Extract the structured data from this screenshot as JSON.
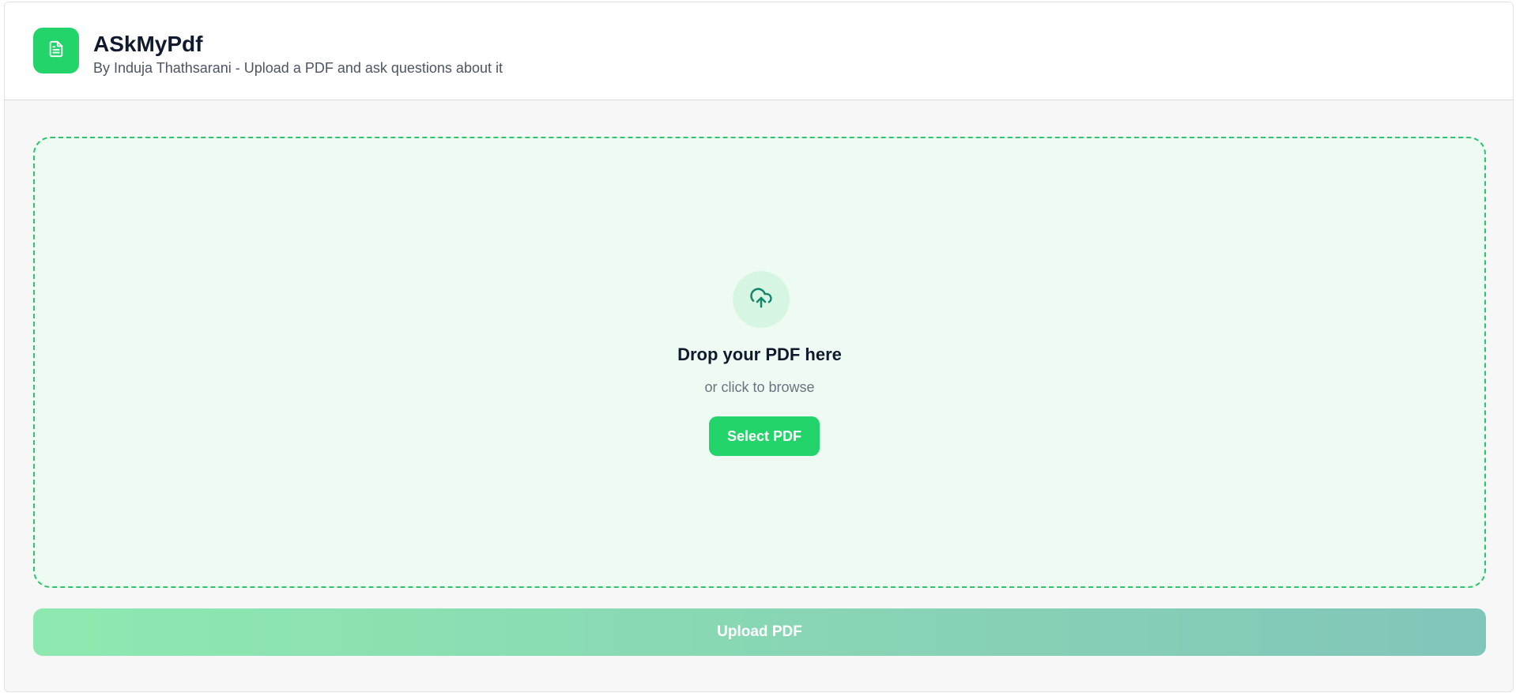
{
  "header": {
    "app_name": "ASkMyPdf",
    "subtitle": "By Induja Thathsarani - Upload a PDF and ask questions about it",
    "logo_icon": "document-icon"
  },
  "dropzone": {
    "icon": "cloud-upload-icon",
    "title": "Drop your PDF here",
    "hint": "or click to browse",
    "select_button_label": "Select PDF"
  },
  "actions": {
    "upload_button_label": "Upload PDF",
    "upload_disabled": true
  },
  "colors": {
    "accent": "#22d46a",
    "dropzone_border": "#2cc66a",
    "dropzone_background": "#edfbf3",
    "upload_gradient_start": "#8ee9b0",
    "upload_gradient_end": "#82c5b9",
    "title_text": "#0f1a2e"
  }
}
